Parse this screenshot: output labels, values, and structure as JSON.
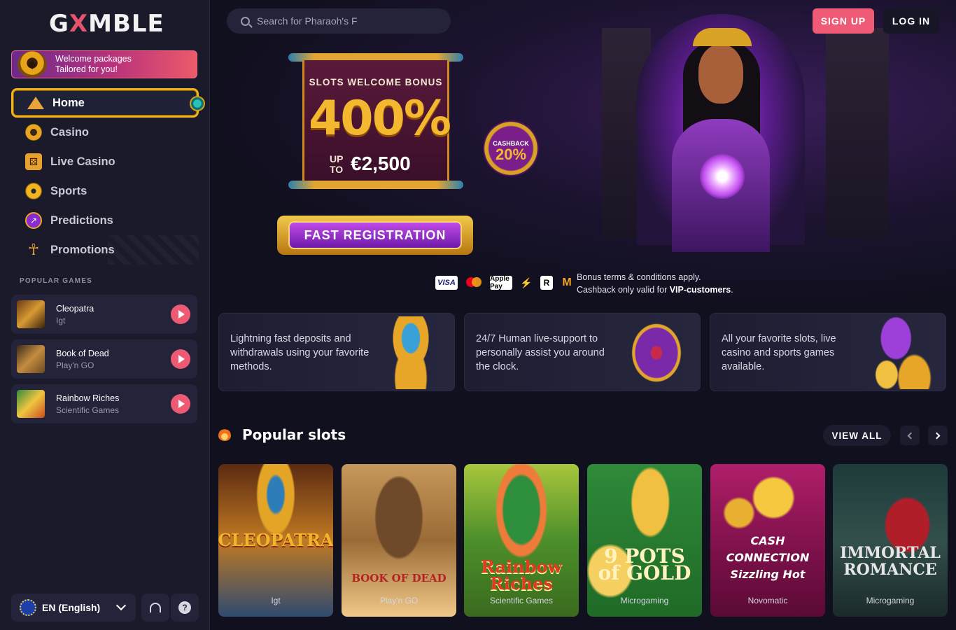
{
  "brand": {
    "logo_left": "G",
    "logo_x": "X",
    "logo_right": "MBLE"
  },
  "promo": {
    "line1": "Welcome packages",
    "line2": "Tailored for you!"
  },
  "nav": [
    {
      "label": "Home",
      "icon": "pyramid-icon",
      "active": true
    },
    {
      "label": "Casino",
      "icon": "coin-icon"
    },
    {
      "label": "Live Casino",
      "icon": "dice-icon"
    },
    {
      "label": "Sports",
      "icon": "football-icon"
    },
    {
      "label": "Predictions",
      "icon": "trend-icon"
    },
    {
      "label": "Promotions",
      "icon": "ankh-icon"
    }
  ],
  "popular_games": {
    "title": "POPULAR GAMES",
    "items": [
      {
        "name": "Cleopatra",
        "provider": "Igt"
      },
      {
        "name": "Book of Dead",
        "provider": "Play'n GO"
      },
      {
        "name": "Rainbow Riches",
        "provider": "Scientific Games"
      }
    ]
  },
  "language": {
    "label": "EN (English)"
  },
  "search": {
    "placeholder": "Search for Pharaoh's F"
  },
  "auth": {
    "signup": "SIGN UP",
    "login": "LOG IN"
  },
  "hero": {
    "banner_title": "SLOTS WELCOME BONUS",
    "percent": "400%",
    "up": "UP",
    "to": "TO",
    "amount": "€2,500",
    "cashback_label": "CASHBACK",
    "cashback_value": "20%",
    "cta": "FAST REGISTRATION",
    "terms_line1": "Bonus terms & conditions apply.",
    "terms_line2_pre": "Cashback only valid for ",
    "terms_line2_bold": "VIP-customers",
    "terms_line2_post": ".",
    "payments": [
      "VISA",
      "Apple Pay",
      "R"
    ]
  },
  "features": [
    {
      "text": "Lightning fast deposits and withdrawals using your favorite methods."
    },
    {
      "text": "24/7 Human live-support to personally assist you around the clock."
    },
    {
      "text": "All your favorite slots, live casino and sports games available."
    }
  ],
  "slots": {
    "title": "Popular slots",
    "view_all": "VIEW ALL",
    "items": [
      {
        "art": "CLEOPATRA",
        "provider": "Igt"
      },
      {
        "art": "BOOK OF DEAD",
        "provider": "Play'n GO"
      },
      {
        "art": "Rainbow Riches",
        "provider": "Scientific Games"
      },
      {
        "art": "9 POTS of GOLD",
        "provider": "Microgaming"
      },
      {
        "art": "CASH CONNECTION Sizzling Hot",
        "provider": "Novomatic"
      },
      {
        "art": "IMMORTAL ROMANCE",
        "provider": "Microgaming"
      }
    ]
  },
  "colors": {
    "accent": "#ef5b76",
    "gold": "#f1b21b",
    "bg": "#11101f",
    "sidebar": "#1a1a2b"
  }
}
